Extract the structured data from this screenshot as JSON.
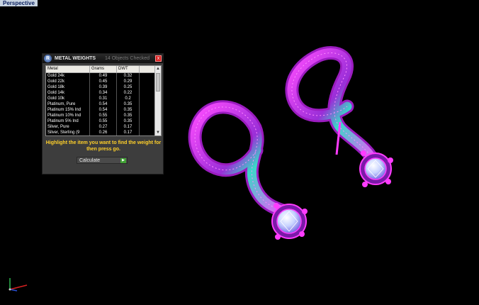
{
  "viewport": {
    "label": "Perspective"
  },
  "panel": {
    "logo_glyph": "R",
    "title": "METAL WEIGHTS",
    "status": "14 Objects Checked",
    "close_glyph": "x",
    "headers": [
      "Metal",
      "Grams",
      "DWT",
      ""
    ],
    "rows": [
      [
        "Gold 24k",
        "0.49",
        "0.32"
      ],
      [
        "Gold 22k",
        "0.45",
        "0.29"
      ],
      [
        "Gold 18k",
        "0.39",
        "0.25"
      ],
      [
        "Gold 14k",
        "0.34",
        "0.22"
      ],
      [
        "Gold 10k",
        "0.31",
        "0.2"
      ],
      [
        "Platinum, Pure",
        "0.54",
        "0.35"
      ],
      [
        "Platinum 15% Ind",
        "0.54",
        "0.35"
      ],
      [
        "Platinum 10% Ind",
        "0.55",
        "0.35"
      ],
      [
        "Platinum 5% Ind",
        "0.55",
        "0.35"
      ],
      [
        "Silver, Pure",
        "0.27",
        "0.17"
      ],
      [
        "Silver, Sterling (9",
        "0.26",
        "0.17"
      ]
    ],
    "scroll_up_glyph": "▲",
    "scroll_down_glyph": "▼",
    "instruction": "Highlight the item you want to find the weight for then press go.",
    "calculate_label": "Calculate",
    "go_glyph": "▶"
  },
  "colors": {
    "wire": "#ff3cff",
    "wire_dark": "#b11ec6",
    "sheen": "#3ad8c8",
    "gem": "#cfd9ff"
  },
  "icons": {
    "axis": "axis-tripod-icon",
    "logo": "rhino-logo-icon",
    "close": "close-icon",
    "go": "play-arrow-icon"
  }
}
